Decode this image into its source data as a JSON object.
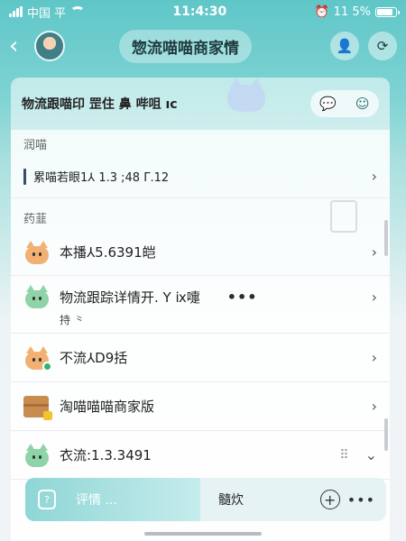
{
  "status_bar": {
    "carrier": "中国 平",
    "time": "11:4:30",
    "battery": "11 5%"
  },
  "nav": {
    "back_icon": "chevron-left-icon",
    "title": "惣流喵喵商家情"
  },
  "top_card": {
    "label": "物流跟喵印 罡住 鼻 哔咀 ıc"
  },
  "sections": {
    "section1": "润喵",
    "section2": "药韮"
  },
  "rows": {
    "row1": {
      "text": "累喵若眼1⅄ 1.3 ;48 Γ.12"
    },
    "row2": {
      "text": "本播⅄5.6391皑"
    },
    "row3": {
      "text": "物流跟踪详情开. Y ⅸ嚏",
      "ellipsis": "•••",
      "subtext": "持 ⺀"
    },
    "row4": {
      "text": "不流⅄D9括"
    },
    "row5": {
      "text": "淘喵喵喵商家版"
    },
    "row6": {
      "text": "衣流:1.3.3491"
    }
  },
  "bottom_bar": {
    "detail_label": "评情 ...",
    "status_label": "髓炊",
    "more": "•••"
  },
  "colors": {
    "accent_teal": "#5fc6c8",
    "brand_cat_orange": "#f2b073",
    "brand_cat_green": "#8fd3a8",
    "status_green": "#2fb36b"
  }
}
